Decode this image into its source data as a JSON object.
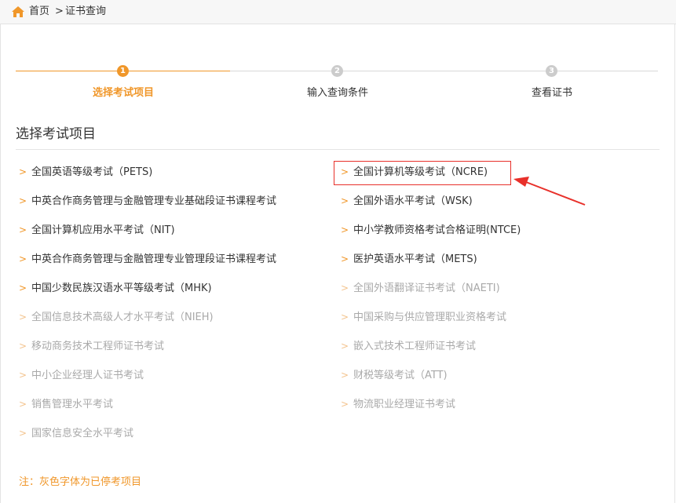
{
  "breadcrumb": {
    "home_icon": "home-icon",
    "home": "首页",
    "separator": ">",
    "current": "证书查询"
  },
  "steps": [
    {
      "number": "1",
      "label": "选择考试项目",
      "active": true
    },
    {
      "number": "2",
      "label": "输入查询条件",
      "active": false
    },
    {
      "number": "3",
      "label": "查看证书",
      "active": false
    }
  ],
  "section": {
    "title": "选择考试项目"
  },
  "exams_left": [
    {
      "label": "全国英语等级考试（PETS)",
      "disabled": false
    },
    {
      "label": "中英合作商务管理与金融管理专业基础段证书课程考试",
      "disabled": false
    },
    {
      "label": "全国计算机应用水平考试（NIT)",
      "disabled": false
    },
    {
      "label": "中英合作商务管理与金融管理专业管理段证书课程考试",
      "disabled": false
    },
    {
      "label": "中国少数民族汉语水平等级考试（MHK)",
      "disabled": false
    },
    {
      "label": "全国信息技术高级人才水平考试（NIEH)",
      "disabled": true
    },
    {
      "label": "移动商务技术工程师证书考试",
      "disabled": true
    },
    {
      "label": "中小企业经理人证书考试",
      "disabled": true
    },
    {
      "label": "销售管理水平考试",
      "disabled": true
    },
    {
      "label": "国家信息安全水平考试",
      "disabled": true
    }
  ],
  "exams_right": [
    {
      "label": "全国计算机等级考试（NCRE)",
      "disabled": false
    },
    {
      "label": "全国外语水平考试（WSK)",
      "disabled": false
    },
    {
      "label": "中小学教师资格考试合格证明(NTCE)",
      "disabled": false
    },
    {
      "label": "医护英语水平考试（METS)",
      "disabled": false
    },
    {
      "label": "全国外语翻译证书考试（NAETI)",
      "disabled": true
    },
    {
      "label": "中国采购与供应管理职业资格考试",
      "disabled": true
    },
    {
      "label": "嵌入式技术工程师证书考试",
      "disabled": true
    },
    {
      "label": "财税等级考试（ATT)",
      "disabled": true
    },
    {
      "label": "物流职业经理证书考试",
      "disabled": true
    }
  ],
  "chevron": ">",
  "note": "注：灰色字体为已停考项目",
  "colors": {
    "accent": "#f0972a",
    "text": "#333333",
    "disabled_text": "#a9a9a9",
    "highlight": "#e8302a"
  }
}
